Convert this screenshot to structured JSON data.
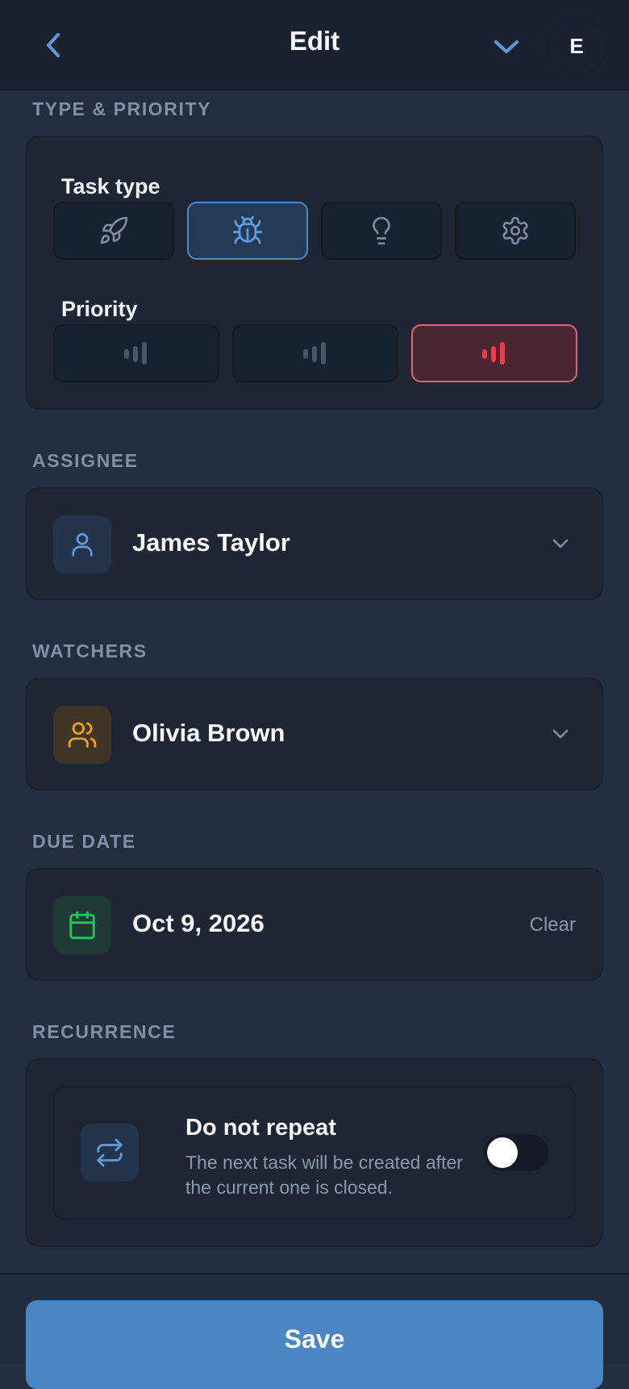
{
  "header": {
    "title": "Edit",
    "avatar_initial": "E",
    "back_icon": "chevron-left-icon",
    "expand_icon": "chevron-down-icon"
  },
  "type_priority": {
    "section_label": "TYPE & PRIORITY",
    "task_type_label": "Task type",
    "task_types": [
      {
        "icon": "rocket-icon",
        "selected": false
      },
      {
        "icon": "bug-icon",
        "selected": true
      },
      {
        "icon": "lightbulb-icon",
        "selected": false
      },
      {
        "icon": "gear-icon",
        "selected": false
      }
    ],
    "priority_label": "Priority",
    "priorities": [
      {
        "icon": "signal-bars-icon",
        "selected": false
      },
      {
        "icon": "signal-bars-icon",
        "selected": false
      },
      {
        "icon": "signal-bars-icon",
        "selected": true
      }
    ]
  },
  "assignee": {
    "section_label": "ASSIGNEE",
    "value": "James Taylor",
    "icon": "user-icon"
  },
  "watchers": {
    "section_label": "WATCHERS",
    "value": "Olivia Brown",
    "icon": "users-icon"
  },
  "due_date": {
    "section_label": "DUE DATE",
    "value": "Oct 9, 2026",
    "clear_label": "Clear",
    "icon": "calendar-icon"
  },
  "recurrence": {
    "section_label": "RECURRENCE",
    "title": "Do not repeat",
    "description": "The next task will be created after the current one is closed.",
    "icon": "repeat-icon",
    "enabled": false
  },
  "footer": {
    "save_label": "Save"
  },
  "colors": {
    "accent": "#4b86c4",
    "priority_high": "#ef3a4a",
    "watchers_accent": "#f59e0b",
    "date_accent": "#22c55e"
  }
}
